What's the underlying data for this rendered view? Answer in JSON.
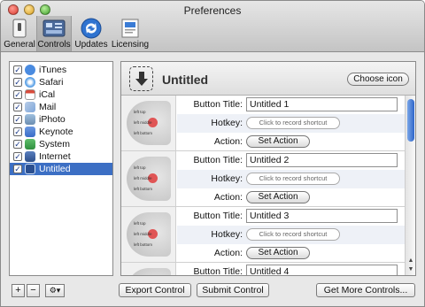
{
  "window": {
    "title": "Preferences"
  },
  "toolbar": {
    "items": [
      {
        "label": "General",
        "icon": "switch-icon"
      },
      {
        "label": "Controls",
        "icon": "controls-icon"
      },
      {
        "label": "Updates",
        "icon": "updates-icon"
      },
      {
        "label": "Licensing",
        "icon": "licensing-icon"
      }
    ],
    "selected": "Controls"
  },
  "sidebar": {
    "items": [
      {
        "label": "iTunes",
        "checked": true,
        "color": "#4a8be0"
      },
      {
        "label": "Safari",
        "checked": true,
        "color": "#5aa0e6"
      },
      {
        "label": "iCal",
        "checked": true,
        "color": "#d94b3b"
      },
      {
        "label": "Mail",
        "checked": true,
        "color": "#7fa6d9"
      },
      {
        "label": "iPhoto",
        "checked": true,
        "color": "#6c8db0"
      },
      {
        "label": "Keynote",
        "checked": true,
        "color": "#3a6cc8"
      },
      {
        "label": "System",
        "checked": true,
        "color": "#2f8f3e"
      },
      {
        "label": "Internet",
        "checked": true,
        "color": "#2d4f8a"
      },
      {
        "label": "Untitled",
        "checked": true,
        "color": "#3a6fc8",
        "selected": true
      }
    ],
    "add_label": "+",
    "remove_label": "−",
    "gear_label": "⚙▾"
  },
  "panel": {
    "title": "Untitled",
    "choose_icon_label": "Choose icon",
    "labels": {
      "button_title": "Button Title:",
      "hotkey": "Hotkey:",
      "action": "Action:"
    },
    "shortcut_placeholder": "Click to record shortcut",
    "set_action_label": "Set Action",
    "thumb_text": {
      "top": "left top",
      "middle": "left middle",
      "bottom": "left bottom"
    },
    "controls": [
      {
        "title": "Untitled 1"
      },
      {
        "title": "Untitled 2"
      },
      {
        "title": "Untitled 3"
      },
      {
        "title": "Untitled 4"
      }
    ]
  },
  "footer": {
    "export_label": "Export Control",
    "submit_label": "Submit Control",
    "more_label": "Get More Controls..."
  }
}
